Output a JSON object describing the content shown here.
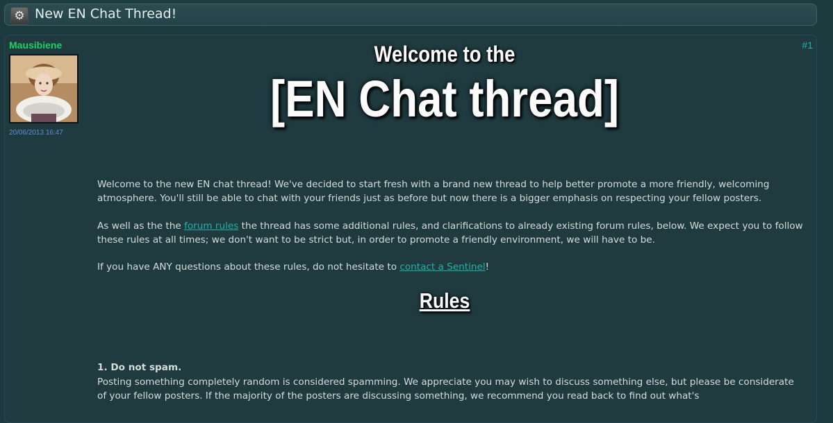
{
  "thread": {
    "title": "New EN Chat Thread!",
    "icon": "gear-icon"
  },
  "post": {
    "author": "Mausibiene",
    "date": "20/06/2013 16:47",
    "number": "#1",
    "avatar": "avatar-portrait"
  },
  "banner": {
    "line1": "Welcome to the",
    "line2": "[EN Chat thread]"
  },
  "body": {
    "intro": "Welcome to the new EN chat thread! We've decided to start fresh with a brand new thread to help better promote a more friendly, welcoming atmosphere. You'll still be able to chat with your friends just as before but now there is a bigger emphasis on respecting your fellow posters.",
    "p2_before": "As well as the the ",
    "p2_link": "forum rules",
    "p2_after": " the thread has some additional rules, and clarifications to already existing forum rules, below. We expect you to follow these rules at all times; we don't want to be strict but, in order to promote a friendly environment, we will have to be.",
    "p3_before": "If you have ANY questions about these rules, do not hesitate to ",
    "p3_link": "contact a Sentinel",
    "p3_after": "!",
    "rules_heading": "Rules",
    "rule1_title": "1. Do not spam.",
    "rule1_text": "Posting something completely random is considered spamming. We appreciate you may wish to discuss something else, but please be considerate of your fellow posters. If the majority of the posters are discussing something, we recommend you read back to find out what's"
  },
  "colors": {
    "background": "#1d3a3f",
    "author": "#20d060",
    "link": "#1fb4a6",
    "date": "#5c8fd8"
  }
}
